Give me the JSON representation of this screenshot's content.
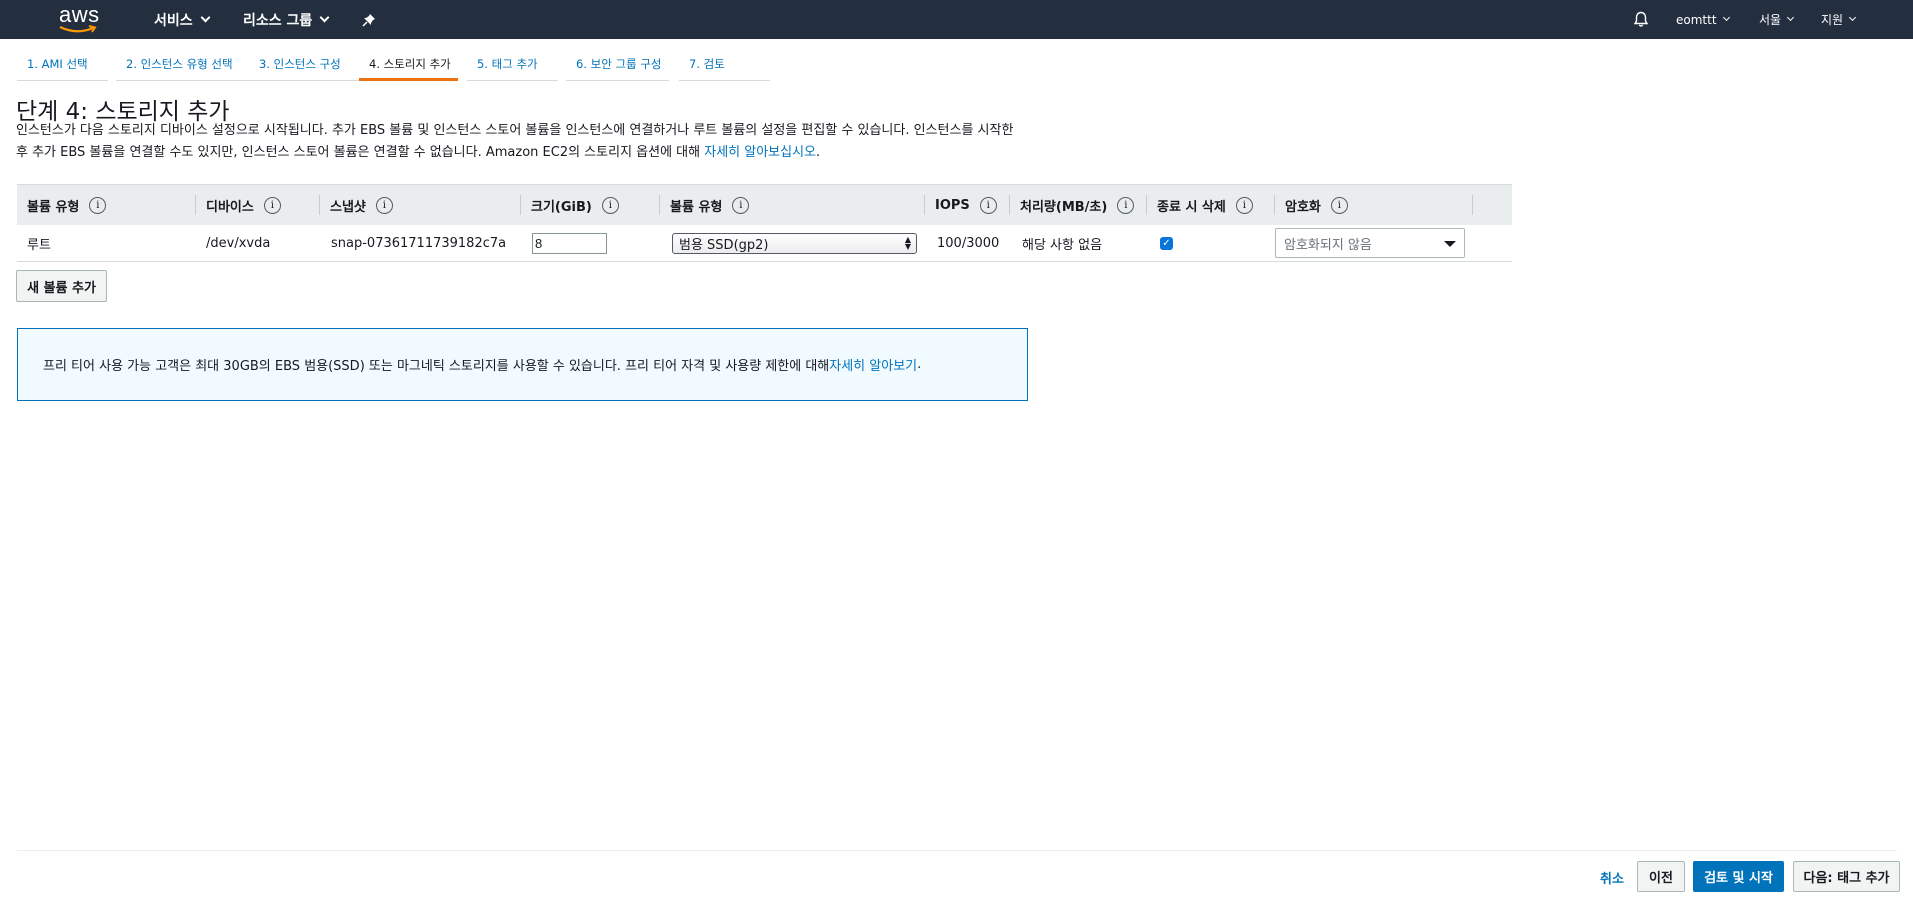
{
  "header": {
    "logo_text": "aws",
    "services_label": "서비스",
    "resource_groups_label": "리소스 그룹",
    "pin_icon": "pin-icon",
    "bell_icon": "bell-icon",
    "account_label": "eomttt",
    "region_label": "서울",
    "support_label": "지원"
  },
  "tabs": [
    {
      "label": "1. AMI 선택"
    },
    {
      "label": "2. 인스턴스 유형 선택"
    },
    {
      "label": "3. 인스턴스 구성"
    },
    {
      "label": "4. 스토리지 추가"
    },
    {
      "label": "5. 태그 추가"
    },
    {
      "label": "6. 보안 그룹 구성"
    },
    {
      "label": "7. 검토"
    }
  ],
  "active_tab": 3,
  "step": {
    "title": "단계 4: 스토리지 추가",
    "description_line1": "인스턴스가 다음 스토리지 디바이스 설정으로 시작됩니다. 추가 EBS 볼륨 및 인스턴스 스토어 볼륨을 인스턴스에 연결하거나 루트 볼륨의 설정을 편집할 수 있습니다. 인스턴스를 시작한",
    "description_line2": "후 추가 EBS 볼륨을 연결할 수도 있지만, 인스턴스 스토어 볼륨은 연결할 수 없습니다. Amazon EC2의 스토리지 옵션에 대해 ",
    "learn_more_link": "자세히 알아보십시오",
    "description_end": "."
  },
  "table": {
    "headers": [
      "볼륨 유형",
      "디바이스",
      "스냅샷",
      "크기(GiB)",
      "볼륨 유형",
      "IOPS",
      "처리량(MB/초)",
      "종료 시 삭제",
      "암호화"
    ],
    "info_glyph": "i",
    "row": {
      "volume_kind": "루트",
      "device": "/dev/xvda",
      "snapshot": "snap-07361711739182c7a",
      "size": "8",
      "volume_type": "범용 SSD(gp2)",
      "iops": "100/3000",
      "throughput": "해당 사항 없음",
      "delete_on_termination": true,
      "encryption": "암호화되지 않음"
    }
  },
  "add_volume_button": "새 볼륨 추가",
  "info_box": {
    "text": "프리 티어 사용 가능 고객은 최대 30GB의 EBS 범용(SSD) 또는 마그네틱 스토리지를 사용할 수 있습니다. 프리 티어 자격 및 사용량 제한에 대해 ",
    "link": "자세히 알아보기",
    "end": "."
  },
  "footer": {
    "cancel": "취소",
    "previous": "이전",
    "review_and_launch": "검토 및 시작",
    "next": "다음: 태그 추가"
  },
  "colors": {
    "nav_bg": "#232f3e",
    "link": "#0073bb",
    "active_tab": "#ec7211",
    "primary_button": "#0073bb"
  }
}
